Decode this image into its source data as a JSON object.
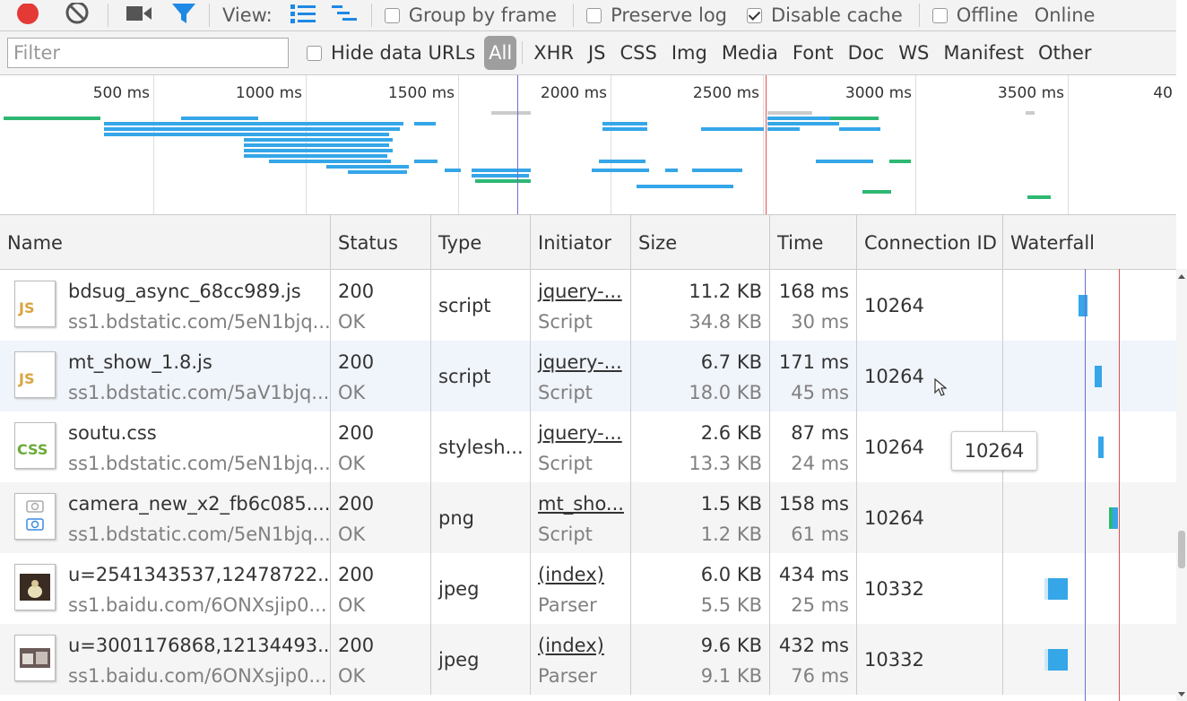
{
  "toolbar": {
    "view_label": "View:",
    "group_by_frame": "Group by frame",
    "preserve_log": "Preserve log",
    "disable_cache": "Disable cache",
    "offline": "Offline",
    "online": "Online"
  },
  "filterbar": {
    "placeholder": "Filter",
    "hide_data_urls": "Hide data URLs",
    "types": [
      "All",
      "XHR",
      "JS",
      "CSS",
      "Img",
      "Media",
      "Font",
      "Doc",
      "WS",
      "Manifest",
      "Other"
    ]
  },
  "overview": {
    "ticks": [
      "500 ms",
      "1000 ms",
      "1500 ms",
      "2000 ms",
      "2500 ms",
      "3000 ms",
      "3500 ms",
      "40"
    ]
  },
  "columns": {
    "name": "Name",
    "status": "Status",
    "type": "Type",
    "initiator": "Initiator",
    "size": "Size",
    "time": "Time",
    "connection": "Connection ID",
    "waterfall": "Waterfall"
  },
  "rows": [
    {
      "name": "bdsug_async_68cc989.js",
      "url": "ss1.bdstatic.com/5eN1bjq...",
      "status": "200",
      "status_text": "OK",
      "type": "script",
      "initiator": "jquery-...",
      "initiator_type": "Script",
      "size": "11.2 KB",
      "content": "34.8 KB",
      "time": "168 ms",
      "latency": "30 ms",
      "conn": "10264",
      "icon": "js-file-icon"
    },
    {
      "name": "mt_show_1.8.js",
      "url": "ss1.bdstatic.com/5aV1bjq...",
      "status": "200",
      "status_text": "OK",
      "type": "script",
      "initiator": "jquery-...",
      "initiator_type": "Script",
      "size": "6.7 KB",
      "content": "18.0 KB",
      "time": "171 ms",
      "latency": "45 ms",
      "conn": "10264",
      "icon": "js-file-icon"
    },
    {
      "name": "soutu.css",
      "url": "ss1.bdstatic.com/5eN1bjq...",
      "status": "200",
      "status_text": "OK",
      "type": "stylesh...",
      "initiator": "jquery-...",
      "initiator_type": "Script",
      "size": "2.6 KB",
      "content": "13.3 KB",
      "time": "87 ms",
      "latency": "24 ms",
      "conn": "10264",
      "icon": "css-file-icon"
    },
    {
      "name": "camera_new_x2_fb6c085....",
      "url": "ss1.bdstatic.com/5eN1bjq...",
      "status": "200",
      "status_text": "OK",
      "type": "png",
      "initiator": "mt_sho...",
      "initiator_type": "Script",
      "size": "1.5 KB",
      "content": "1.2 KB",
      "time": "158 ms",
      "latency": "61 ms",
      "conn": "10264",
      "icon": "camera-image-icon"
    },
    {
      "name": "u=2541343537,12478722...",
      "url": "ss1.baidu.com/6ONXsjip0...",
      "status": "200",
      "status_text": "OK",
      "type": "jpeg",
      "initiator": "(index)",
      "initiator_type": "Parser",
      "size": "6.0 KB",
      "content": "5.5 KB",
      "time": "434 ms",
      "latency": "25 ms",
      "conn": "10332",
      "icon": "photo-thumbnail-icon"
    },
    {
      "name": "u=3001176868,12134493...",
      "url": "ss1.baidu.com/6ONXsjip0...",
      "status": "200",
      "status_text": "OK",
      "type": "jpeg",
      "initiator": "(index)",
      "initiator_type": "Parser",
      "size": "9.6 KB",
      "content": "9.1 KB",
      "time": "432 ms",
      "latency": "76 ms",
      "conn": "10332",
      "icon": "photo-thumbnail-icon"
    }
  ],
  "tooltip": "10264",
  "colors": {
    "record": "#e53935",
    "filter": "#1e88e5",
    "bar_blue": "#35a6e8",
    "bar_green": "#2eb872",
    "dom_line": "#6b6bd6",
    "load_line": "#e05050"
  }
}
